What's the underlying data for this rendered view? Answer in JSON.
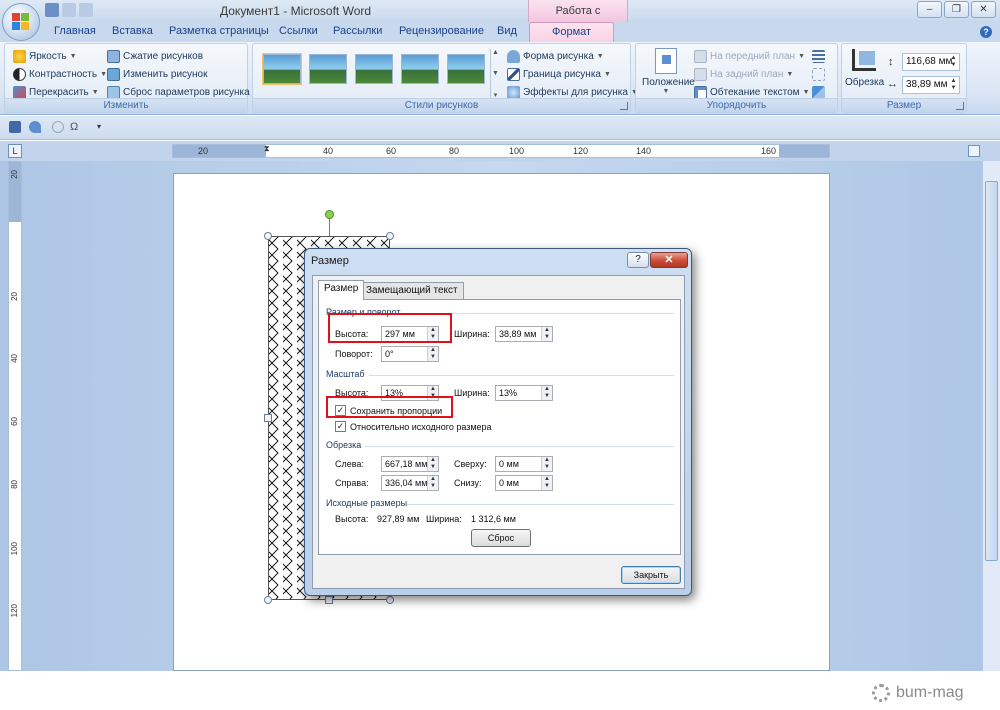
{
  "window": {
    "title": "Документ1 - Microsoft Word",
    "contextual_group": "Работа с рисунками"
  },
  "tabs": [
    "Главная",
    "Вставка",
    "Разметка страницы",
    "Ссылки",
    "Рассылки",
    "Рецензирование",
    "Вид",
    "Формат"
  ],
  "active_tab": "Формат",
  "ribbon": {
    "adjust": {
      "label": "Изменить",
      "brightness": "Яркость",
      "contrast": "Контрастность",
      "recolor": "Перекрасить",
      "compress": "Сжатие рисунков",
      "change": "Изменить рисунок",
      "reset": "Сброс параметров рисунка"
    },
    "styles": {
      "label": "Стили рисунков",
      "shape": "Форма рисунка",
      "border": "Граница рисунка",
      "effects": "Эффекты для рисунка"
    },
    "arrange": {
      "label": "Упорядочить",
      "position": "Положение",
      "bring_front": "На передний план",
      "send_back": "На задний план",
      "wrap": "Обтекание текстом"
    },
    "size": {
      "label": "Размер",
      "crop": "Обрезка",
      "height": "116,68 мм",
      "width": "38,89 мм"
    }
  },
  "ruler": {
    "h_numbers": [
      "20",
      "40",
      "60",
      "80",
      "100",
      "120",
      "140",
      "160"
    ],
    "v_numbers": [
      "20",
      "20",
      "40",
      "60",
      "80",
      "100",
      "120"
    ]
  },
  "dialog": {
    "title": "Размер",
    "help": "?",
    "close": "✕",
    "tab_size": "Размер",
    "tab_alt": "Замещающий текст",
    "section_size_rotate": "Размер и поворот",
    "height_label": "Высота:",
    "height_value": "297 мм",
    "width_label": "Ширина:",
    "width_value": "38,89 мм",
    "rotation_label": "Поворот:",
    "rotation_value": "0°",
    "section_scale": "Масштаб",
    "scale_height_label": "Высота:",
    "scale_height_value": "13%",
    "scale_width_label": "Ширина:",
    "scale_width_value": "13%",
    "lock_aspect": "Сохранить пропорции",
    "lock_aspect_checked": true,
    "relative_original": "Относительно исходного размера",
    "relative_original_checked": true,
    "section_crop": "Обрезка",
    "left_label": "Слева:",
    "left_value": "667,18 мм",
    "top_label": "Сверху:",
    "top_value": "0 мм",
    "right_label": "Справа:",
    "right_value": "336,04 мм",
    "bottom_label": "Снизу:",
    "bottom_value": "0 мм",
    "section_original": "Исходные размеры",
    "orig_height_label": "Высота:",
    "orig_height_value": "927,89 мм",
    "orig_width_label": "Ширина:",
    "orig_width_value": "1 312,6 мм",
    "reset_btn": "Сброс",
    "close_btn": "Закрыть"
  },
  "watermark": "bum-mag"
}
